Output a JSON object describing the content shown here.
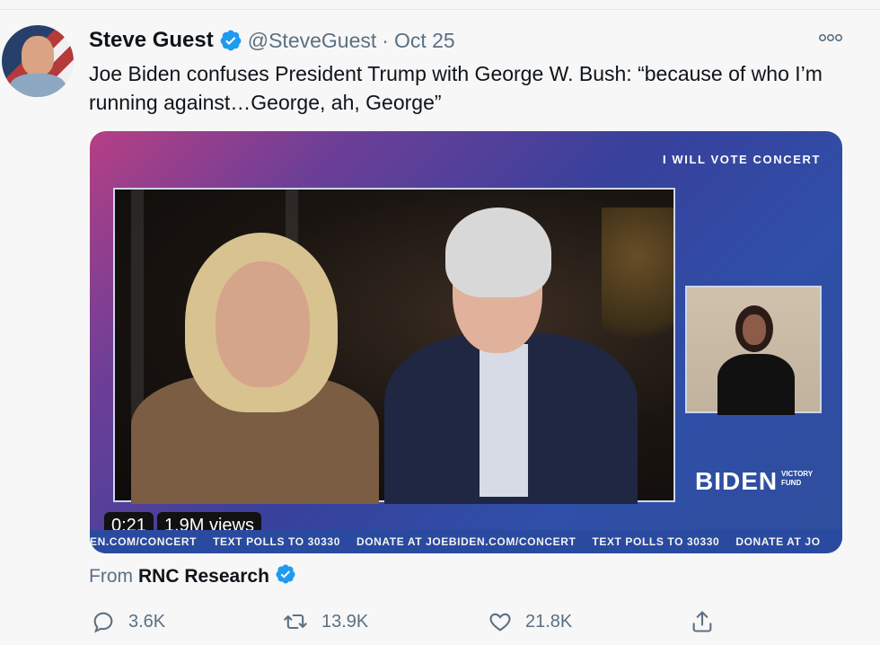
{
  "tweet": {
    "author": {
      "name": "Steve Guest",
      "handle": "@SteveGuest"
    },
    "date": "Oct 25",
    "separator": "·",
    "text": "Joe Biden confuses President Trump with George W. Bush: “because of who I’m running against…George, ah, George”",
    "media": {
      "video_time": "0:21",
      "views": "1.9M views",
      "tagline": "I WILL VOTE CONCERT",
      "brand": "BIDEN",
      "brand_sub": "VICTORY FUND",
      "banner": [
        "EN.COM/CONCERT",
        "TEXT POLLS TO 30330",
        "DONATE AT JOEBIDEN.COM/CONCERT",
        "TEXT POLLS TO 30330",
        "DONATE AT JO"
      ]
    },
    "from_label": "From",
    "from_source": "RNC Research",
    "actions": {
      "reply_count": "3.6K",
      "retweet_count": "13.9K",
      "like_count": "21.8K"
    }
  },
  "colors": {
    "verified": "#1d9bf0",
    "secondary_text": "#5b7083",
    "primary_text": "#0f1419"
  },
  "icons": [
    "verified-badge-icon",
    "more-icon",
    "reply-icon",
    "retweet-icon",
    "like-icon",
    "share-icon"
  ]
}
